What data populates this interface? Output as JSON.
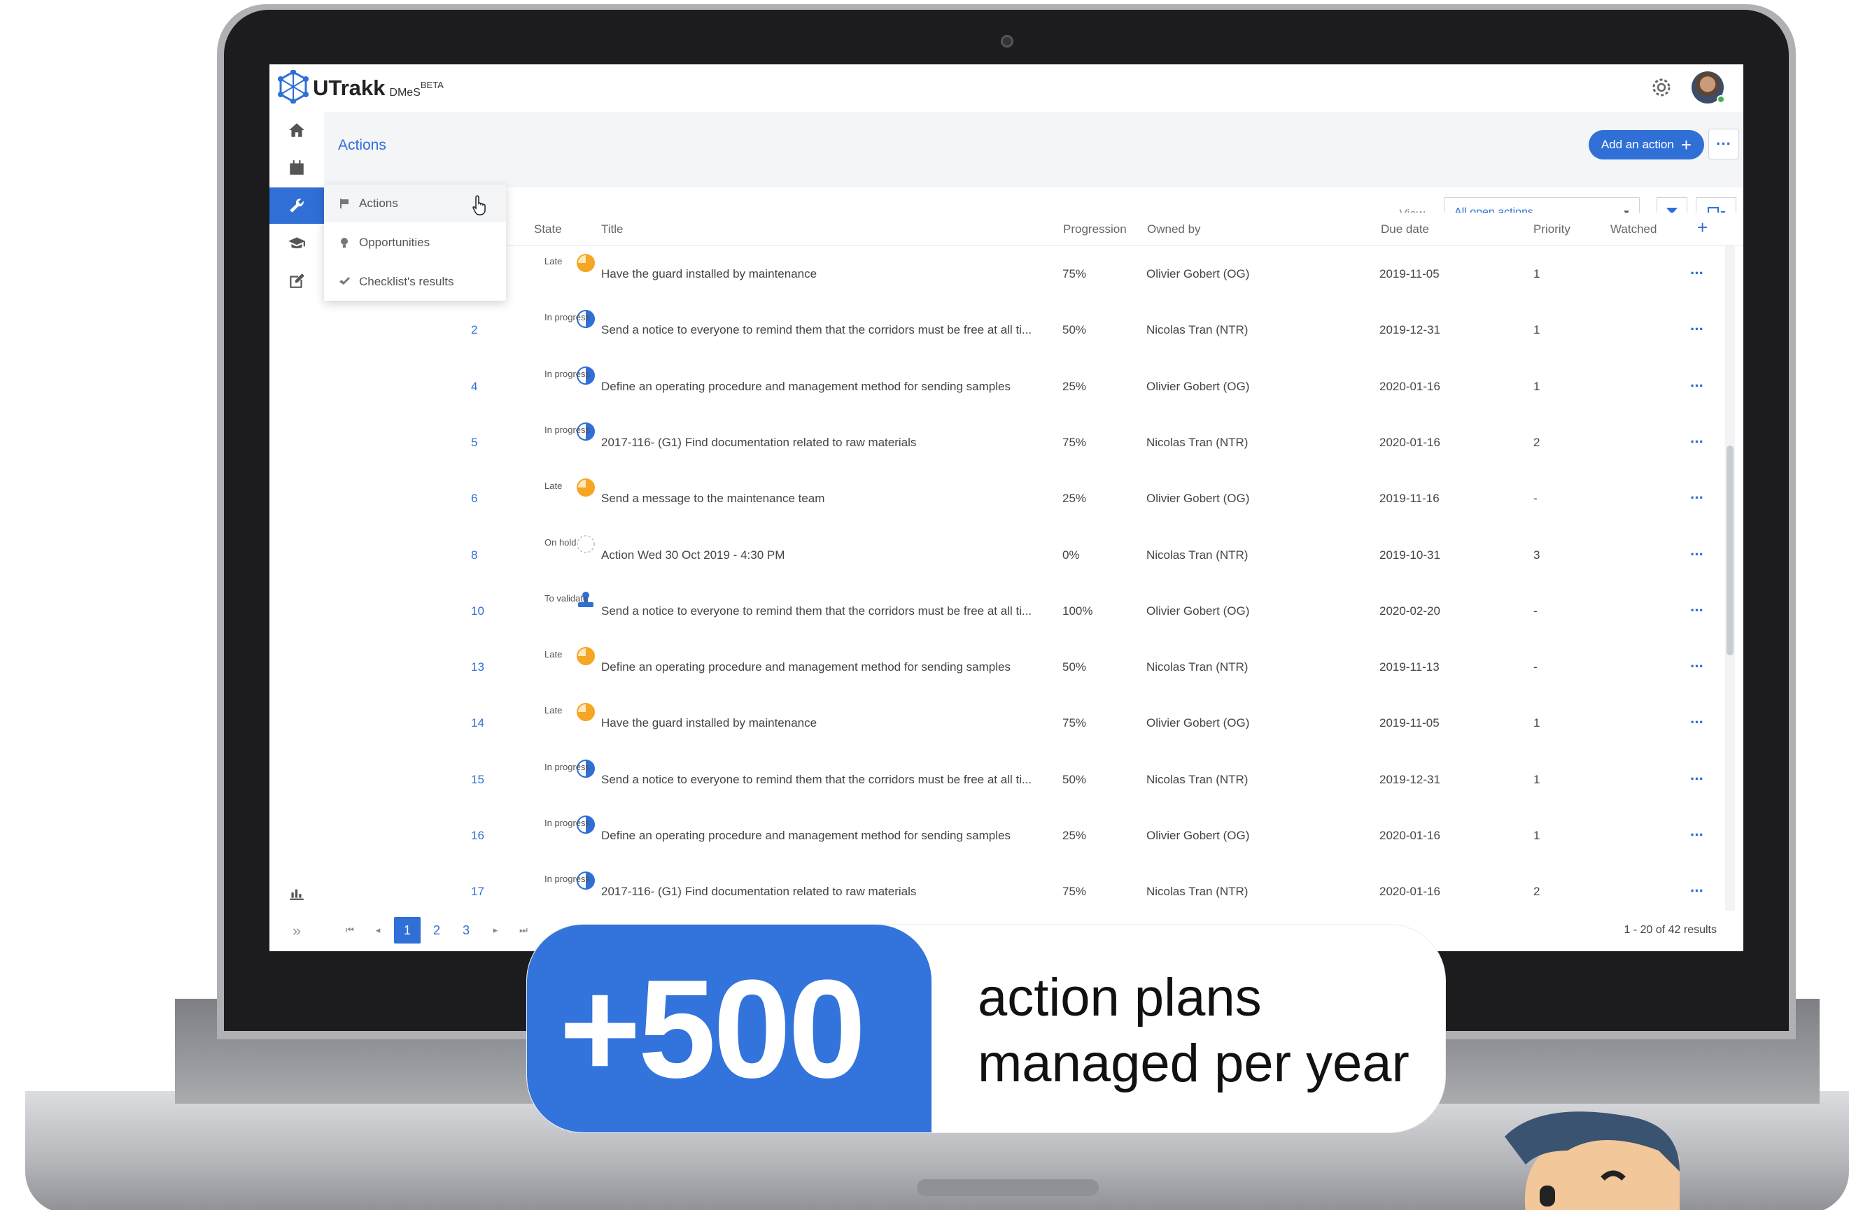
{
  "app": {
    "name": "UTrakk",
    "module": "DMeS",
    "badge": "BETA"
  },
  "header": {
    "page_title": "Actions",
    "add_button": "Add an action"
  },
  "view": {
    "label": "View",
    "selected": "All open actions"
  },
  "menu": {
    "items": [
      "Actions",
      "Opportunities",
      "Checklist's results"
    ]
  },
  "table": {
    "columns": {
      "state": "State",
      "title": "Title",
      "progression": "Progression",
      "owner": "Owned by",
      "due": "Due date",
      "priority": "Priority",
      "watched": "Watched"
    },
    "rows": [
      {
        "num": "",
        "state": "Late",
        "title": "Have the guard installed by maintenance",
        "progress": "75%",
        "owner": "Olivier Gobert (OG)",
        "due": "2019-11-05",
        "priority": "1"
      },
      {
        "num": "2",
        "state": "In progress",
        "title": "Send a notice to everyone to remind them that the corridors must be free at all ti...",
        "progress": "50%",
        "owner": "Nicolas Tran (NTR)",
        "due": "2019-12-31",
        "priority": "1"
      },
      {
        "num": "4",
        "state": "In progress",
        "title": "Define an operating procedure and management method for sending samples",
        "progress": "25%",
        "owner": "Olivier Gobert (OG)",
        "due": "2020-01-16",
        "priority": "1"
      },
      {
        "num": "5",
        "state": "In progress",
        "title": "2017-116- (G1) Find documentation related to raw materials",
        "progress": "75%",
        "owner": "Nicolas Tran (NTR)",
        "due": "2020-01-16",
        "priority": "2"
      },
      {
        "num": "6",
        "state": "Late",
        "title": "Send a message to the maintenance team",
        "progress": "25%",
        "owner": "Olivier Gobert (OG)",
        "due": "2019-11-16",
        "priority": "-"
      },
      {
        "num": "8",
        "state": "On hold",
        "title": "Action Wed 30 Oct 2019 - 4:30 PM",
        "progress": "0%",
        "owner": "Nicolas Tran (NTR)",
        "due": "2019-10-31",
        "priority": "3"
      },
      {
        "num": "10",
        "state": "To validate",
        "title": "Send a notice to everyone to remind them that the corridors must be free at all ti...",
        "progress": "100%",
        "owner": "Olivier Gobert (OG)",
        "due": "2020-02-20",
        "priority": "-"
      },
      {
        "num": "13",
        "state": "Late",
        "title": "Define an operating procedure and management method for sending samples",
        "progress": "50%",
        "owner": "Nicolas Tran (NTR)",
        "due": "2019-11-13",
        "priority": "-"
      },
      {
        "num": "14",
        "state": "Late",
        "title": "Have the guard installed by maintenance",
        "progress": "75%",
        "owner": "Olivier Gobert (OG)",
        "due": "2019-11-05",
        "priority": "1"
      },
      {
        "num": "15",
        "state": "In progress",
        "title": "Send a notice to everyone to remind them that the corridors must be free at all ti...",
        "progress": "50%",
        "owner": "Nicolas Tran (NTR)",
        "due": "2019-12-31",
        "priority": "1"
      },
      {
        "num": "16",
        "state": "In progress",
        "title": "Define an operating procedure and management method for sending samples",
        "progress": "25%",
        "owner": "Olivier Gobert (OG)",
        "due": "2020-01-16",
        "priority": "1"
      },
      {
        "num": "17",
        "state": "In progress",
        "title": "2017-116- (G1) Find documentation related to raw materials",
        "progress": "75%",
        "owner": "Nicolas Tran (NTR)",
        "due": "2020-01-16",
        "priority": "2"
      }
    ]
  },
  "pagination": {
    "pages": [
      "1",
      "2",
      "3"
    ],
    "current": "1",
    "results": "1 - 20 of 42 results"
  },
  "banner": {
    "number": "+500",
    "line1": "action plans",
    "line2": "managed per year"
  },
  "colors": {
    "accent": "#2f6fd6",
    "late": "#f5a623",
    "banner_blue": "#3273dc"
  }
}
